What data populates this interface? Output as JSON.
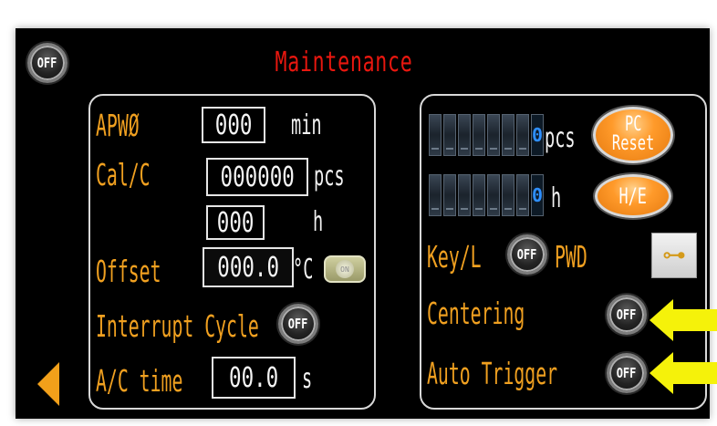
{
  "header": {
    "title": "Maintenance",
    "off_button": "OFF"
  },
  "left": {
    "apwo": {
      "label": "APWØ",
      "value": "000",
      "unit": "min"
    },
    "calc": {
      "label": "Cal/C",
      "value": "000000",
      "unit": "pcs",
      "value2": "000",
      "unit2": "h"
    },
    "offset": {
      "label": "Offset",
      "value": "000.0",
      "unit": "°C",
      "toggle": "ON"
    },
    "interrupt": {
      "label": "Interrupt Cycle",
      "button": "OFF"
    },
    "ac_time": {
      "label": "A/C time",
      "value": "00.0",
      "unit": "s"
    }
  },
  "right": {
    "counter_pcs": {
      "value": "0",
      "unit": "pcs"
    },
    "counter_h": {
      "value": "0",
      "unit": "h"
    },
    "pc_reset": {
      "line1": "PC",
      "line2": "Reset"
    },
    "he_button": "H/E",
    "keyl": {
      "label": "Key/L",
      "button": "OFF",
      "suffix": "PWD"
    },
    "centering": {
      "label": "Centering",
      "button": "OFF"
    },
    "auto_trigger": {
      "label": "Auto Trigger",
      "button": "OFF"
    }
  },
  "icons": {
    "back": "left-triangle-icon",
    "key": "key-icon",
    "annotation": "yellow-arrow-icon"
  },
  "colors": {
    "label_orange": "#f0a020",
    "title_red": "#e8170f",
    "annotation_yellow": "#f5f20a"
  }
}
